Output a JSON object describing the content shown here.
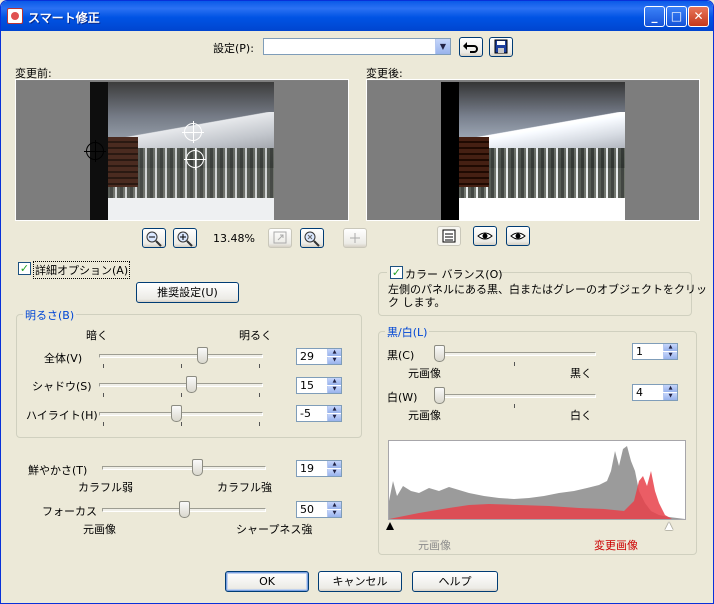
{
  "window": {
    "title": "スマート修正",
    "minimize_glyph": "_",
    "maximize_glyph": "□",
    "close_glyph": "✕"
  },
  "settings": {
    "label": "設定(P):",
    "value": ""
  },
  "before": {
    "label": "変更前:"
  },
  "after": {
    "label": "変更後:"
  },
  "zoom": {
    "level": "13.48%"
  },
  "icons": {
    "zoom_out": "magnifier-minus-icon",
    "zoom_in": "magnifier-plus-icon",
    "fit": "fit-window-icon",
    "actual": "actual-size-icon",
    "move": "move-crosshair-icon"
  },
  "advanced": {
    "label": "詳細オプション(A)",
    "checked": true
  },
  "recommend_button": "推奨設定(U)",
  "brightness": {
    "title": "明るさ(B)",
    "dark_label": "暗く",
    "bright_label": "明るく",
    "rows": [
      {
        "label": "全体(V)",
        "value": "29",
        "position": 0.64
      },
      {
        "label": "シャドウ(S)",
        "value": "15",
        "position": 0.57
      },
      {
        "label": "ハイライト(H)",
        "value": "-5",
        "position": 0.47
      }
    ]
  },
  "vividness": {
    "label": "鮮やかさ(T)",
    "value": "19",
    "position": 0.59,
    "left_caption": "カラフル弱",
    "right_caption": "カラフル強"
  },
  "focus": {
    "label": "フォーカス",
    "value": "50",
    "position": 0.5,
    "left_caption": "元画像",
    "right_caption": "シャープネス強"
  },
  "color_balance": {
    "label": "カラー バランス(O)",
    "checked": true,
    "description_line1": "左側のパネルにある黒、白またはグレーのオブジェクトをクリッ",
    "description_line2": "ク します。"
  },
  "black_white": {
    "title": "黒/白(L)",
    "black": {
      "label": "黒(C)",
      "value": "1",
      "left_caption": "元画像",
      "right_caption": "黒く",
      "position": 0.0
    },
    "white": {
      "label": "白(W)",
      "value": "4",
      "left_caption": "元画像",
      "right_caption": "白く",
      "position": 0.0
    }
  },
  "histogram": {
    "left_label": "元画像",
    "right_label": "変更画像",
    "gray_color": "#9b9b9b",
    "red_color": "#e8414a"
  },
  "buttons": {
    "ok": "OK",
    "cancel": "キャンセル",
    "help": "ヘルプ"
  }
}
